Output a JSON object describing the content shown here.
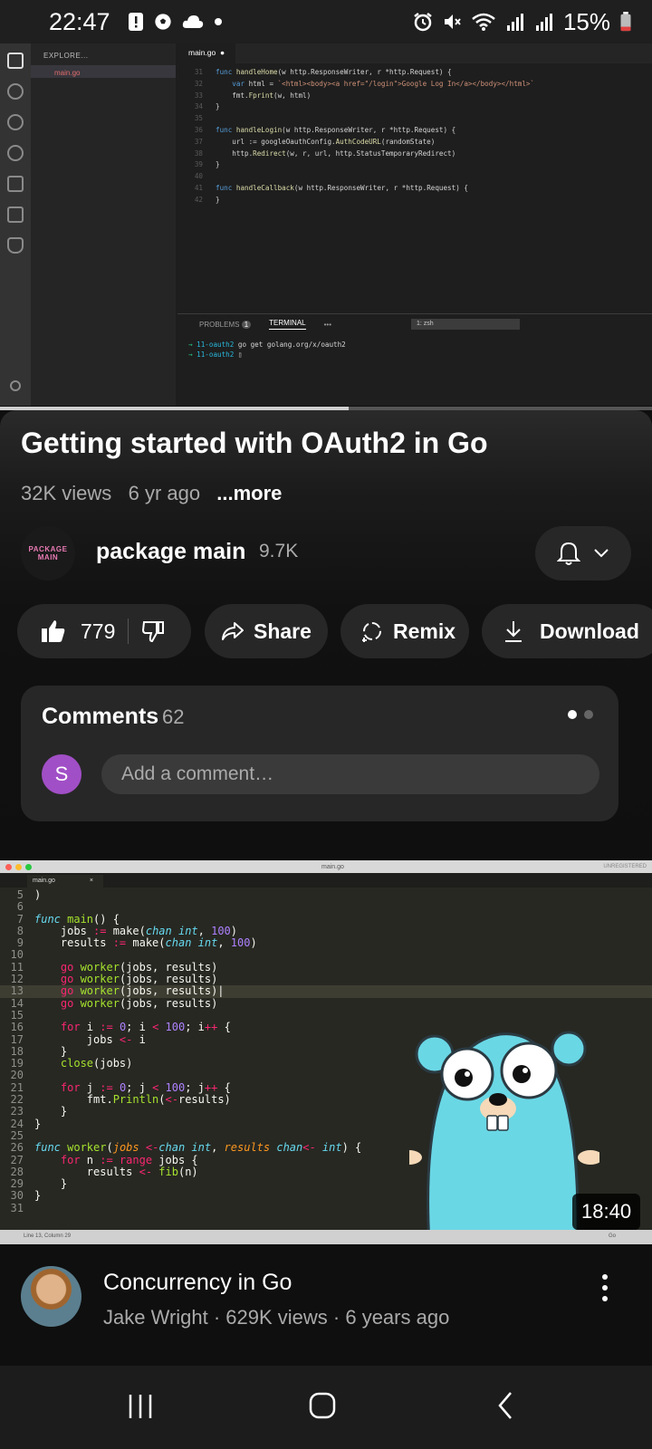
{
  "status_bar": {
    "time": "22:47",
    "battery": "15%"
  },
  "video_player": {
    "vscode": {
      "explorer_header": "EXPLORE...",
      "open_file": "main.go",
      "tab_label": "main.go",
      "code_lines": [
        {
          "n": "31",
          "t": "func handleHome(w http.ResponseWriter, r *http.Request) {"
        },
        {
          "n": "32",
          "t": "    var html = `<html><body><a href=\"/login\">Google Log In</a></body></html>`"
        },
        {
          "n": "33",
          "t": "    fmt.Fprint(w, html)"
        },
        {
          "n": "34",
          "t": "}"
        },
        {
          "n": "35",
          "t": ""
        },
        {
          "n": "36",
          "t": "func handleLogin(w http.ResponseWriter, r *http.Request) {"
        },
        {
          "n": "37",
          "t": "    url := googleOauthConfig.AuthCodeURL(randomState)"
        },
        {
          "n": "38",
          "t": "    http.Redirect(w, r, url, http.StatusTemporaryRedirect)"
        },
        {
          "n": "39",
          "t": "}"
        },
        {
          "n": "40",
          "t": ""
        },
        {
          "n": "41",
          "t": "func handleCallback(w http.ResponseWriter, r *http.Request) {"
        },
        {
          "n": "42",
          "t": "}"
        }
      ],
      "panel_tabs": {
        "problems": "PROBLEMS",
        "problems_count": "1",
        "terminal": "TERMINAL",
        "more": "•••",
        "shell": "1: zsh"
      },
      "terminal_lines": [
        {
          "arrow": "→",
          "path": "11-oauth2",
          "cmd": "go get golang.org/x/oauth2"
        },
        {
          "arrow": "→",
          "path": "11-oauth2",
          "cmd": "▯"
        }
      ]
    },
    "progress_fraction": 0.535
  },
  "video": {
    "title": "Getting started with OAuth2 in Go",
    "views": "32K views",
    "age": "6 yr ago",
    "more": "...more"
  },
  "channel": {
    "avatar_text_line1": "PACKAGE",
    "avatar_text_line2": "MAIN",
    "name": "package main",
    "subscribers": "9.7K"
  },
  "actions": {
    "likes": "779",
    "share": "Share",
    "remix": "Remix",
    "download": "Download"
  },
  "comments": {
    "title": "Comments",
    "count": "62",
    "avatar_letter": "S",
    "placeholder": "Add a comment…"
  },
  "next_video": {
    "editor": {
      "window_title": "main.go",
      "unregistered": "UNREGISTERED",
      "tab": "main.go",
      "status_line": "Line 13, Column 29",
      "lang": "Go"
    },
    "duration": "18:40",
    "title": "Concurrency in Go",
    "meta": "Jake Wright · 629K views · 6 years ago"
  },
  "colors": {
    "accent_comment_avatar": "#a14fc6",
    "like_active": "#ffffff"
  }
}
